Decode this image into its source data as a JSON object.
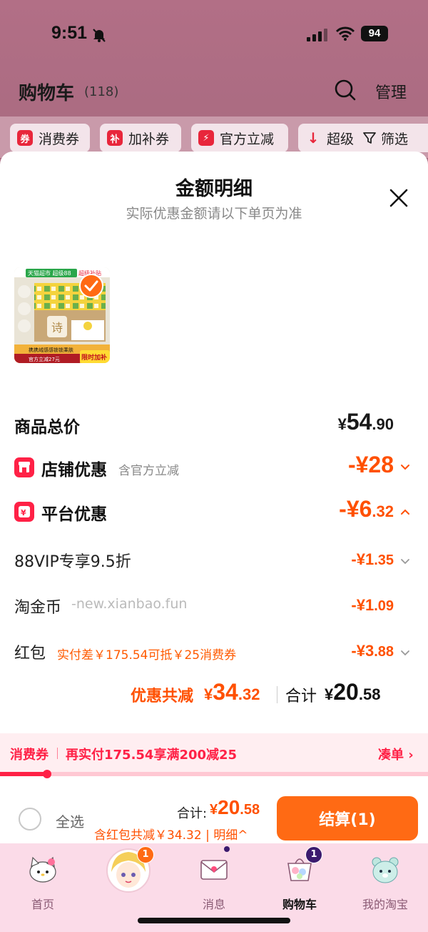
{
  "status_bar": {
    "time": "9:51",
    "battery": "94"
  },
  "header": {
    "title": "购物车",
    "count": "(118)",
    "manage_label": "管理"
  },
  "filters": [
    {
      "icon_text": "券",
      "label": "消费券"
    },
    {
      "icon_text": "补",
      "label": "加补券"
    },
    {
      "icon_text": "⚡",
      "label": "官方立减"
    },
    {
      "icon_text": "↓",
      "label": "超级"
    }
  ],
  "filter_button": "筛选",
  "sheet": {
    "title": "金额明细",
    "subtitle": "实际优惠金额请以下单页为准"
  },
  "product_image": {
    "top_left_text": "天猫超市 超级88",
    "top_right_text": "超级补贴",
    "brand_mark": "诗",
    "bottom_text": "携携绒感感锁锁乘肤",
    "bottom_sub": "官方立减27元",
    "limited_tag": "限时加补"
  },
  "rows": {
    "total_price": {
      "label": "商品总价",
      "currency": "¥",
      "int": "54",
      "dec": ".90"
    },
    "shop_discount": {
      "label": "店铺优惠",
      "note": "含官方立减",
      "prefix": "-¥",
      "int": "28",
      "dec": ""
    },
    "platform_discount": {
      "label": "平台优惠",
      "prefix": "-¥",
      "int": "6",
      "dec": ".32"
    },
    "vip": {
      "label": "88VIP专享9.5折",
      "prefix": "-¥",
      "int": "1",
      "dec": ".35"
    },
    "gold_coin": {
      "label": "淘金币",
      "watermark": "-new.xianbao.fun",
      "prefix": "-¥",
      "int": "1",
      "dec": ".09"
    },
    "red_packet": {
      "label": "红包",
      "note": "实付差￥175.54可抵￥25消费券",
      "prefix": "-¥",
      "int": "3",
      "dec": ".88"
    }
  },
  "summary": {
    "discount_label": "优惠共减",
    "discount_currency": "¥",
    "discount_int": "34",
    "discount_dec": ".32",
    "total_label": "合计",
    "total_currency": "¥",
    "total_int": "20",
    "total_dec": ".58"
  },
  "coupon_bar": {
    "tag": "消费券",
    "text": "再实付175.54享满200减25",
    "link": "凑单 ›",
    "progress": 0.11
  },
  "checkout": {
    "select_all": "全选",
    "total_label": "合计:",
    "total_currency": "¥",
    "total_int": "20",
    "total_dec": ".58",
    "sub_text": "含红包共减￥34.32 | 明细^",
    "button": "结算(1)"
  },
  "tabbar": [
    {
      "label": "首页",
      "icon": "hello-kitty-icon"
    },
    {
      "label": "",
      "icon": "anime-avatar-icon",
      "badge": "1"
    },
    {
      "label": "消息",
      "icon": "envelope-icon"
    },
    {
      "label": "购物车",
      "icon": "cart-icon",
      "badge": "1"
    },
    {
      "label": "我的淘宝",
      "icon": "bear-icon"
    }
  ],
  "colors": {
    "accent_orange": "#ff5000",
    "accent_red": "#ff2146",
    "header_bg": "#a86a80",
    "tabbar_bg": "#fbdbe8"
  }
}
